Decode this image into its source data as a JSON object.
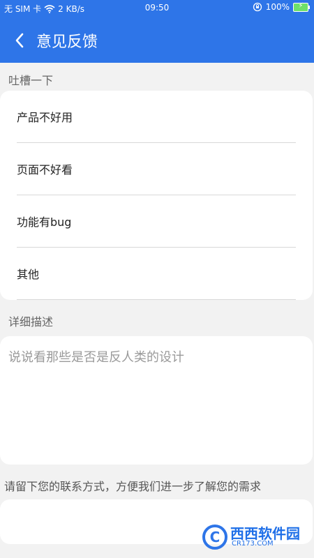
{
  "status_bar": {
    "sim_status": "无 SIM 卡",
    "speed": "2 KB/s",
    "time": "09:50",
    "battery": "100%"
  },
  "header": {
    "title": "意见反馈"
  },
  "section_complaint": {
    "label": "吐槽一下",
    "options": [
      "产品不好用",
      "页面不好看",
      "功能有bug",
      "其他"
    ]
  },
  "section_detail": {
    "label": "详细描述",
    "placeholder": "说说看那些是否是反人类的设计"
  },
  "section_contact": {
    "label": "请留下您的联系方式，方便我们进一步了解您的需求",
    "placeholder": ""
  },
  "watermark": {
    "letter": "C",
    "brand": "西西软件园",
    "domain": "CR173.COM"
  },
  "colors": {
    "header": "#2e75e8",
    "background": "#f2f2f2",
    "card": "#ffffff"
  },
  "icons": {
    "back": "chevron-left-icon",
    "wifi": "wifi-icon",
    "lock": "rotation-lock-icon",
    "battery": "battery-charging-icon"
  }
}
